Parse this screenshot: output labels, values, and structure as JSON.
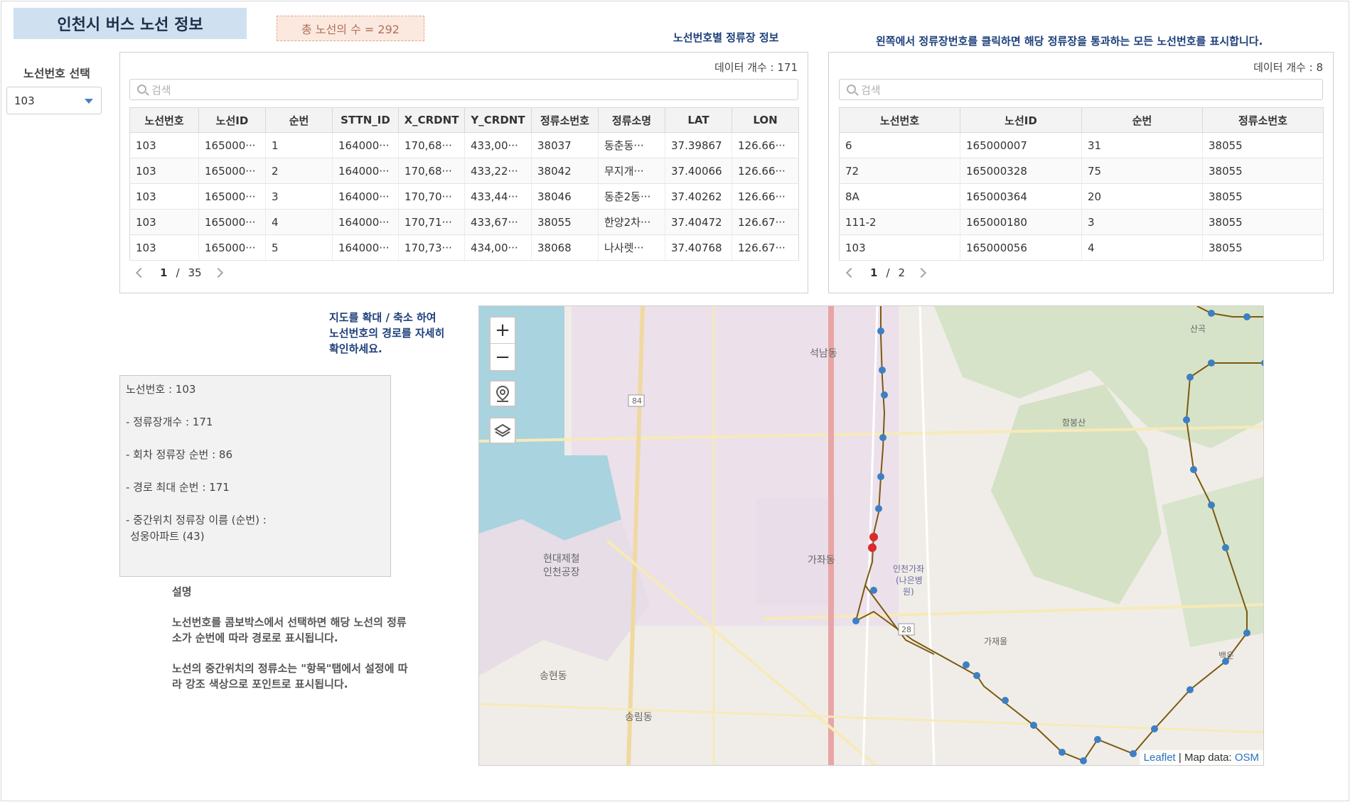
{
  "header": {
    "title": "인천시 버스 노선 정보",
    "total_routes": "총 노선의 수 = 292"
  },
  "route_select": {
    "label": "노선번호 선택",
    "value": "103"
  },
  "stops_table": {
    "heading": "노선번호별 정류장 정보",
    "data_count": "데이터 개수 : 171",
    "search_placeholder": "검색",
    "columns": [
      "노선번호",
      "노선ID",
      "순번",
      "STTN_ID",
      "X_CRDNT",
      "Y_CRDNT",
      "정류소번호",
      "정류소명",
      "LAT",
      "LON"
    ],
    "rows": [
      [
        "103",
        "165000···",
        "1",
        "164000···",
        "170,68···",
        "433,00···",
        "38037",
        "동춘동···",
        "37.39867",
        "126.66···"
      ],
      [
        "103",
        "165000···",
        "2",
        "164000···",
        "170,68···",
        "433,22···",
        "38042",
        "무지개···",
        "37.40066",
        "126.66···"
      ],
      [
        "103",
        "165000···",
        "3",
        "164000···",
        "170,70···",
        "433,44···",
        "38046",
        "동춘2동···",
        "37.40262",
        "126.66···"
      ],
      [
        "103",
        "165000···",
        "4",
        "164000···",
        "170,71···",
        "433,67···",
        "38055",
        "한양2차···",
        "37.40472",
        "126.67···"
      ],
      [
        "103",
        "165000···",
        "5",
        "164000···",
        "170,73···",
        "434,00···",
        "38068",
        "나사렛···",
        "37.40768",
        "126.67···"
      ]
    ],
    "page": "1",
    "page_sep": "/",
    "total_pages": "35"
  },
  "routes_table": {
    "heading": "왼쪽에서 정류장번호를 클릭하면 해당 정류장을 통과하는 모든 노선번호를 표시합니다.",
    "data_count": "데이터 개수 : 8",
    "search_placeholder": "검색",
    "columns": [
      "노선번호",
      "노선ID",
      "순번",
      "정류소번호"
    ],
    "rows": [
      [
        "6",
        "165000007",
        "31",
        "38055"
      ],
      [
        "72",
        "165000328",
        "75",
        "38055"
      ],
      [
        "8A",
        "165000364",
        "20",
        "38055"
      ],
      [
        "111-2",
        "165000180",
        "3",
        "38055"
      ],
      [
        "103",
        "165000056",
        "4",
        "38055"
      ]
    ],
    "page": "1",
    "page_sep": "/",
    "total_pages": "2"
  },
  "map_hint": {
    "line1": "지도를  확대 / 축소 하여",
    "line2": "노선번호의 경로를 자세히",
    "line3": "확인하세요."
  },
  "route_info": {
    "route_no": "노선번호 : 103",
    "stop_count": "- 정류장개수 : 171",
    "turn_seq": "- 회차 정류장 순번 : 86",
    "max_seq": "- 경로 최대 순번 : 171",
    "mid_label": "- 중간위치 정류장 이름 (순번)  :",
    "mid_value": "성웅아파트 (43)"
  },
  "description": {
    "title": "설명",
    "p1_line1": "노선번호를 콤보박스에서 선택하면 해당 노선의 정류",
    "p1_line2": "소가 순번에 따라 경로로 표시됩니다.",
    "p2_line1": "노선의 중간위치의 정류소는 \"항목\"탭에서 설정에 따",
    "p2_line2": "라 강조 색상으로 포인트로 표시됩니다."
  },
  "map": {
    "zoom_in": "+",
    "zoom_out": "−",
    "attribution_leaflet": "Leaflet",
    "attribution_sep": " | Map data: ",
    "attribution_osm": "OSM",
    "labels": {
      "l1": "석남동",
      "l2": "가좌동",
      "l3": "현대제철",
      "l4": "인천공장",
      "l5": "송림동",
      "l6": "송현동",
      "l7": "가재울",
      "l8": "산곡",
      "l9": "함봉산",
      "l10": "백운",
      "l11": "인천가좌",
      "l12": "(나은병",
      "l13": "원)",
      "l14": "84",
      "l15": "28"
    },
    "colors": {
      "route": "#7a5a10",
      "stop": "#3d7fc4",
      "highlight": "#d92b2b"
    }
  }
}
